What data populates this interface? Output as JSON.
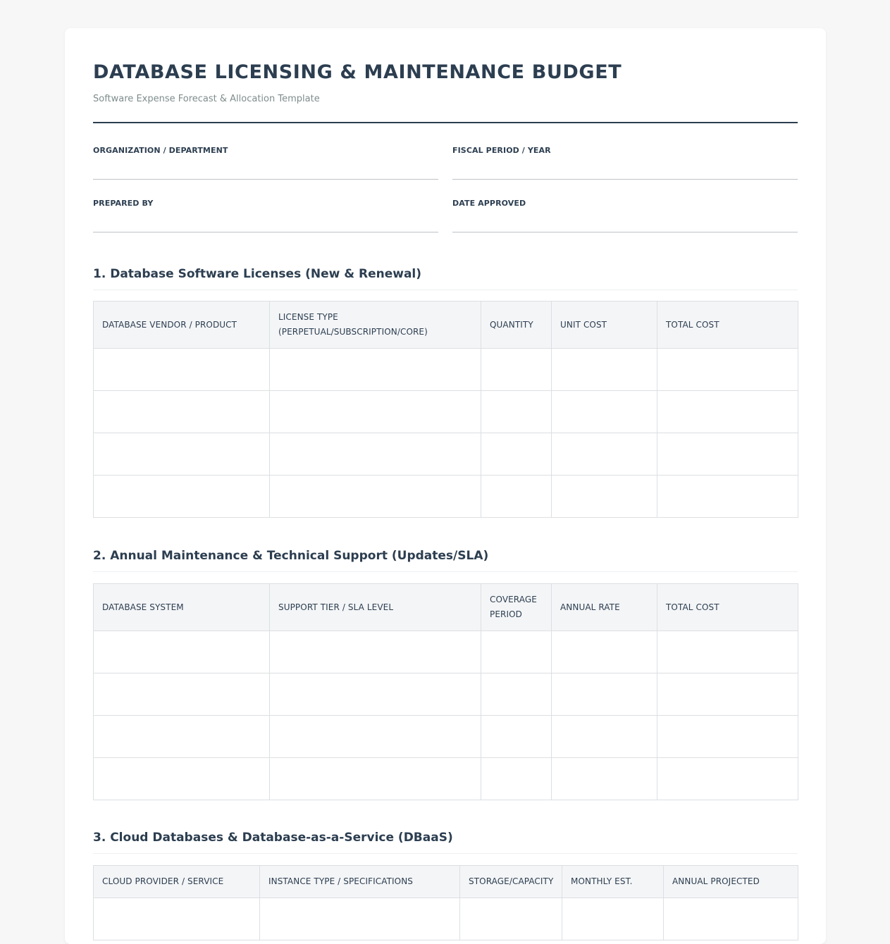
{
  "document": {
    "title": "DATABASE LICENSING & MAINTENANCE BUDGET",
    "subtitle": "Software Expense Forecast & Allocation Template"
  },
  "fields": {
    "organization": "ORGANIZATION / DEPARTMENT",
    "fiscal_period": "FISCAL PERIOD / YEAR",
    "prepared_by": "PREPARED BY",
    "date_approved": "DATE APPROVED"
  },
  "sections": [
    {
      "title": "1. Database Software Licenses (New & Renewal)",
      "columns": [
        "DATABASE VENDOR / PRODUCT",
        "LICENSE TYPE (PERPETUAL/SUBSCRIPTION/CORE)",
        "QUANTITY",
        "UNIT COST",
        "TOTAL COST"
      ]
    },
    {
      "title": "2. Annual Maintenance & Technical Support (Updates/SLA)",
      "columns": [
        "DATABASE SYSTEM",
        "SUPPORT TIER / SLA LEVEL",
        "COVERAGE PERIOD",
        "ANNUAL RATE",
        "TOTAL COST"
      ]
    },
    {
      "title": "3. Cloud Databases & Database-as-a-Service (DBaaS)",
      "columns": [
        "CLOUD PROVIDER / SERVICE",
        "INSTANCE TYPE / SPECIFICATIONS",
        "STORAGE/CAPACITY",
        "MONTHLY EST.",
        "ANNUAL PROJECTED"
      ]
    }
  ]
}
